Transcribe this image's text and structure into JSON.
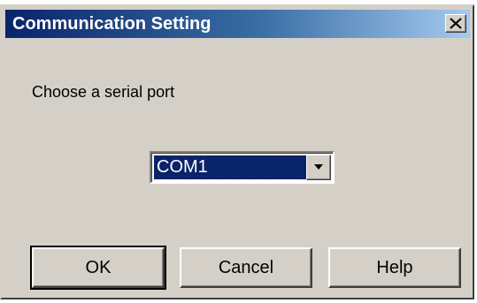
{
  "window": {
    "title": "Communication Setting",
    "close_icon": "close-icon"
  },
  "form": {
    "prompt": "Choose a serial port",
    "serial_port": {
      "selected": "COM1",
      "arrow_icon": "chevron-down-icon"
    }
  },
  "buttons": {
    "ok": "OK",
    "cancel": "Cancel",
    "help": "Help"
  },
  "colors": {
    "title_gradient_start": "#0a246a",
    "title_gradient_end": "#a6caf0",
    "face": "#d4d0c8",
    "selection": "#0a246a"
  }
}
